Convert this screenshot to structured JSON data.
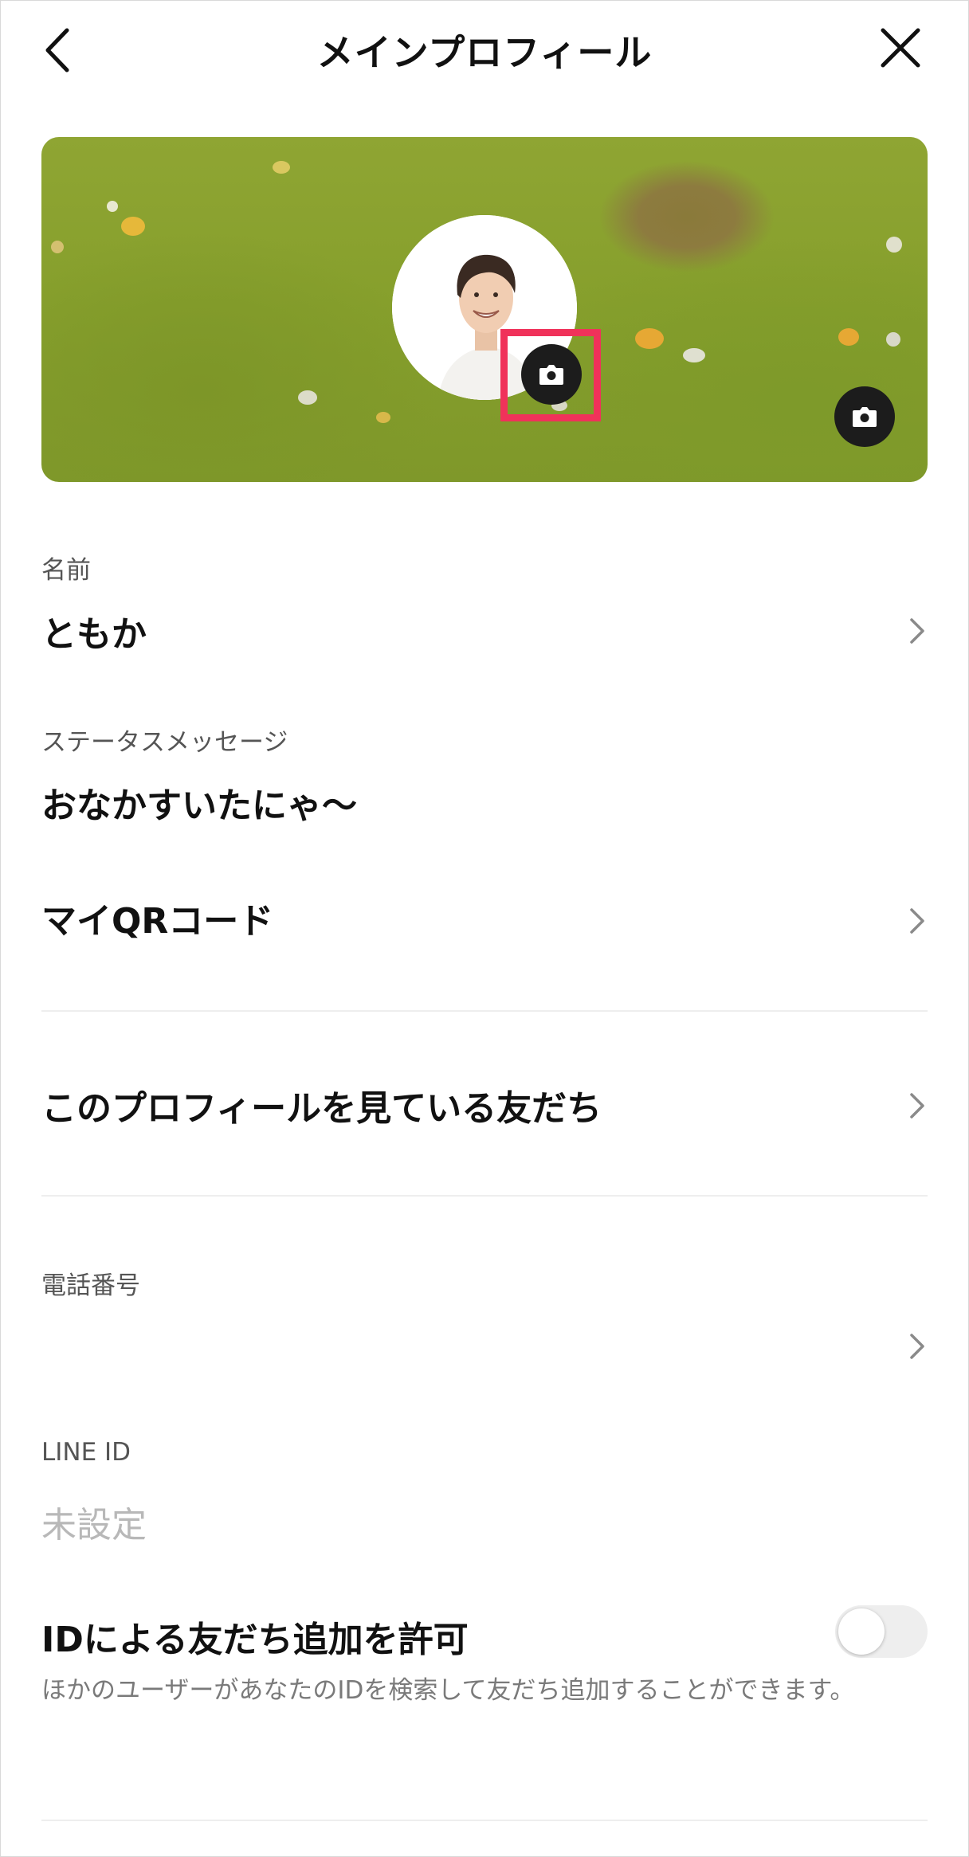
{
  "header": {
    "title": "メインプロフィール",
    "back_icon": "chevron-left-icon",
    "close_icon": "close-icon"
  },
  "cover": {
    "avatar_icon": "profile-photo",
    "avatar_camera_icon": "camera-icon",
    "cover_camera_icon": "camera-icon",
    "highlight_color": "#f0325a"
  },
  "profile": {
    "name_label": "名前",
    "name_value": "ともか",
    "status_label": "ステータスメッセージ",
    "status_value": "おなかすいたにゃ～",
    "qr_label": "マイQRコード",
    "viewers_label": "このプロフィールを見ている友だち",
    "phone_label": "電話番号",
    "line_id_label": "LINE ID",
    "line_id_value": "未設定",
    "allow_id_label": "IDによる友だち追加を許可",
    "allow_id_enabled": false,
    "allow_id_description": "ほかのユーザーがあなたのIDを検索して友だち追加することができます。"
  }
}
